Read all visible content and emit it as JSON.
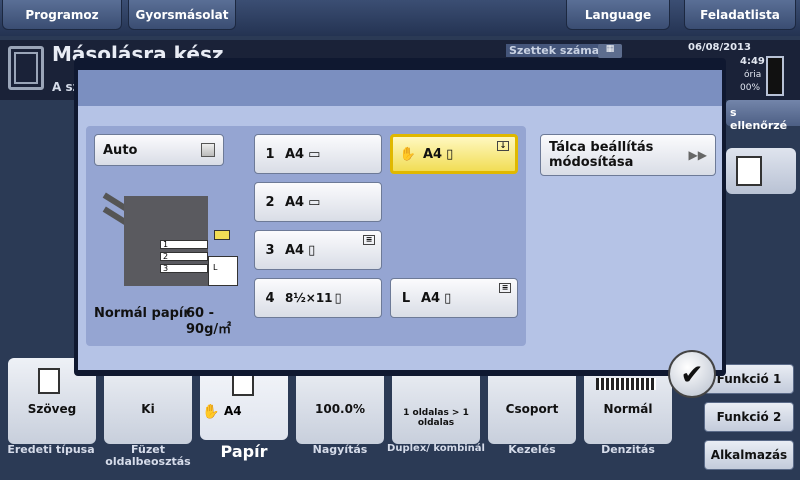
{
  "topbar": {
    "programs": "Programoz",
    "quick_copy": "Gyorsmásolat",
    "language": "Language",
    "job_list": "Feladatlista"
  },
  "status": {
    "title": "Másolásra kész",
    "subtitle": "A sz",
    "sets_label": "Szettek száma",
    "date": "06/08/2013",
    "time": "4:49",
    "memory_label": "ória",
    "memory_value": "00%",
    "side_check": "s ellenőrzé"
  },
  "dialog": {
    "auto_label": "Auto",
    "trays": [
      {
        "num": "1",
        "size": "A4"
      },
      {
        "num": "2",
        "size": "A4"
      },
      {
        "num": "3",
        "size": "A4"
      },
      {
        "num": "4",
        "size": "8½×11"
      }
    ],
    "selected_tray": {
      "size": "A4"
    },
    "bypass_tray": {
      "num": "L",
      "size": "A4"
    },
    "tray_setting_btn": {
      "line1": "Tálca beállítás",
      "line2": "módosítása"
    },
    "paper_type_label": "Normál papír",
    "paper_weight_line1": "60 -",
    "paper_weight_line2": "90g/㎡",
    "diagram_trays": [
      "1",
      "2",
      "3"
    ],
    "diagram_bypass": "L"
  },
  "tiles": [
    {
      "value": "Szöveg",
      "caption": "Eredeti típusa"
    },
    {
      "value": "Ki",
      "caption": "Füzet oldalbeosztás"
    },
    {
      "value": "A4",
      "caption": "Papír"
    },
    {
      "value": "100.0%",
      "caption": "Nagyítás"
    },
    {
      "value": "1 oldalas > 1 oldalas",
      "caption": "Duplex/ kombinál"
    },
    {
      "value": "Csoport",
      "caption": "Kezelés"
    },
    {
      "value": "Normál",
      "caption": "Denzitás"
    }
  ],
  "functions": {
    "f1": "Funkció 1",
    "f2": "Funkció 2",
    "apps": "Alkalmazás"
  },
  "colors": {
    "accent_selected": "#f1dd55",
    "dialog_bg": "#b5c3e6"
  }
}
